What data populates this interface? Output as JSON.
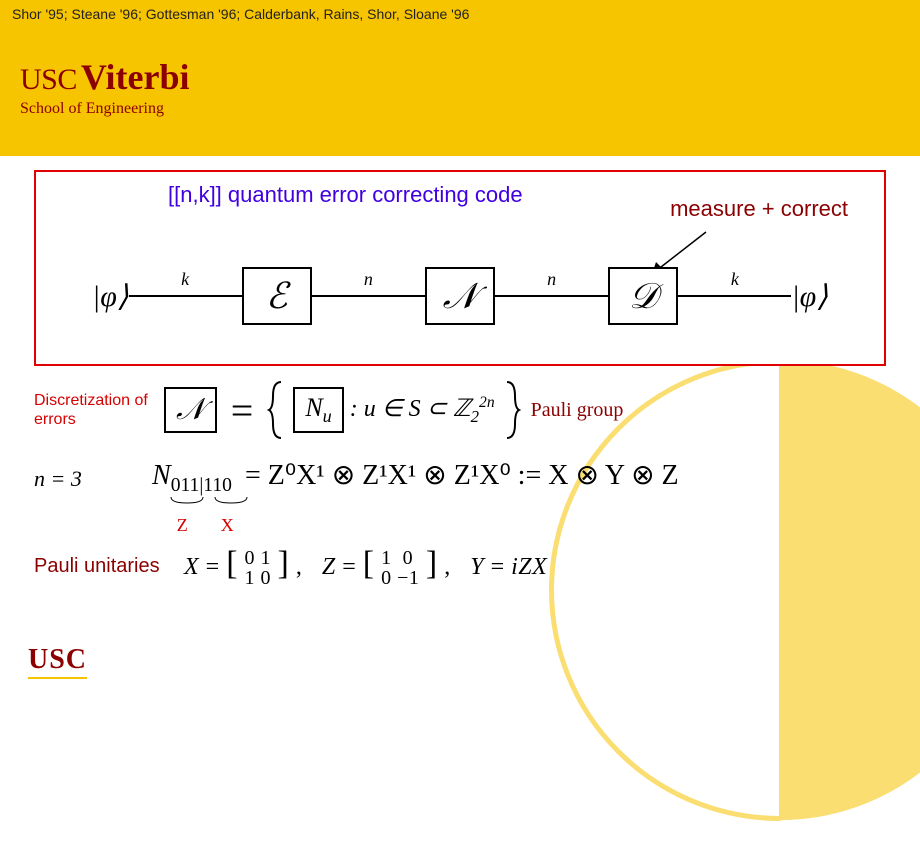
{
  "citation": "Shor '95; Steane '96; Gottesman '96; Calderbank, Rains, Shor, Sloane '96",
  "viterbi": {
    "usc": "USC",
    "main": "Viterbi",
    "sub": "School of Engineering"
  },
  "redbox": {
    "title": "[[n,k]] quantum error correcting code",
    "measure": "measure + correct",
    "ket_in": "|φ⟩",
    "ket_out": "|φ⟩",
    "wires": [
      "k",
      "n",
      "n",
      "k"
    ],
    "boxes": [
      "ℰ",
      "𝒩",
      "𝒟"
    ]
  },
  "discretization": "Discretization of errors",
  "eqN": {
    "lhs": "𝒩",
    "eq": "=",
    "Nu": "N",
    "Nu_sub": "u",
    "cond": ": u ∈ S ⊂ ℤ",
    "exp": "2n",
    "base2": "2",
    "pauli_group": "Pauli group"
  },
  "example": {
    "n3": "n = 3",
    "Nsub": "N",
    "bits_z": "011",
    "bits_x": "110",
    "rhs": "= Z⁰X¹ ⊗ Z¹X¹ ⊗ Z¹X⁰ := X ⊗ Y ⊗ Z",
    "zlabel": "Z",
    "xlabel": "X"
  },
  "pauli": {
    "label": "Pauli unitaries",
    "X": "X = [ 0 1 ; 1 0 ] ,",
    "Z": "Z = [ 1 0 ; 0 −1 ] ,",
    "Y": "Y = iZX"
  },
  "usc_logo": "USC"
}
